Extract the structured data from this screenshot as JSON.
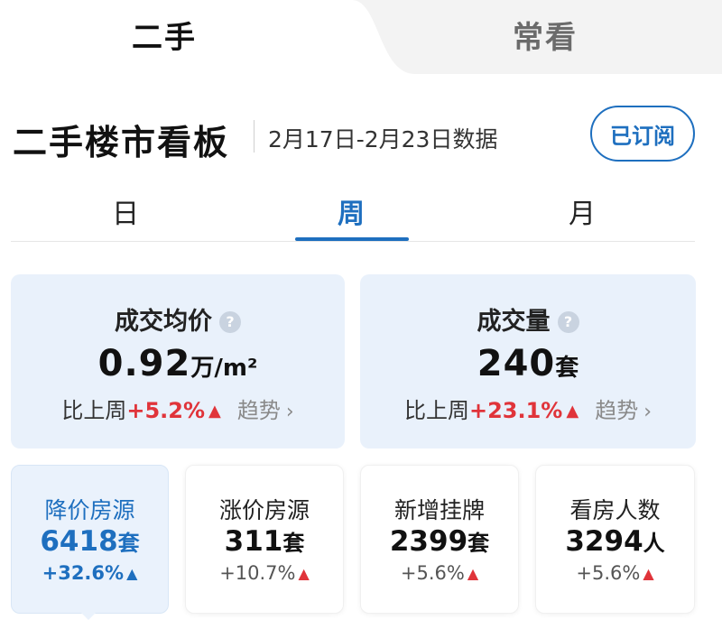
{
  "top_tabs": [
    {
      "label": "二手",
      "active": true
    },
    {
      "label": "常看",
      "active": false
    }
  ],
  "header": {
    "title": "二手楼市看板",
    "date_range": "2月17日-2月23日数据",
    "subscribe_label": "已订阅"
  },
  "period_tabs": [
    {
      "label": "日",
      "active": false
    },
    {
      "label": "周",
      "active": true
    },
    {
      "label": "月",
      "active": false
    }
  ],
  "big_cards": [
    {
      "label": "成交均价",
      "help_icon": "?",
      "value": "0.92",
      "unit": "万/m²",
      "compare_label": "比上周",
      "change": "+5.2%",
      "direction": "up",
      "trend_label": "趋势"
    },
    {
      "label": "成交量",
      "help_icon": "?",
      "value": "240",
      "unit": "套",
      "compare_label": "比上周",
      "change": "+23.1%",
      "direction": "up",
      "trend_label": "趋势"
    }
  ],
  "small_cards": [
    {
      "label": "降价房源",
      "value": "6418",
      "unit": "套",
      "change": "+32.6%",
      "selected": true
    },
    {
      "label": "涨价房源",
      "value": "311",
      "unit": "套",
      "change": "+10.7%",
      "selected": false
    },
    {
      "label": "新增挂牌",
      "value": "2399",
      "unit": "套",
      "change": "+5.6%",
      "selected": false
    },
    {
      "label": "看房人数",
      "value": "3294",
      "unit": "人",
      "change": "+5.6%",
      "selected": false
    }
  ],
  "glyphs": {
    "up_triangle": "▲",
    "chevron_right": "›"
  },
  "colors": {
    "accent_blue": "#1e6fbf",
    "up_red": "#e0343a",
    "card_blue_bg": "#e9f1fb"
  }
}
